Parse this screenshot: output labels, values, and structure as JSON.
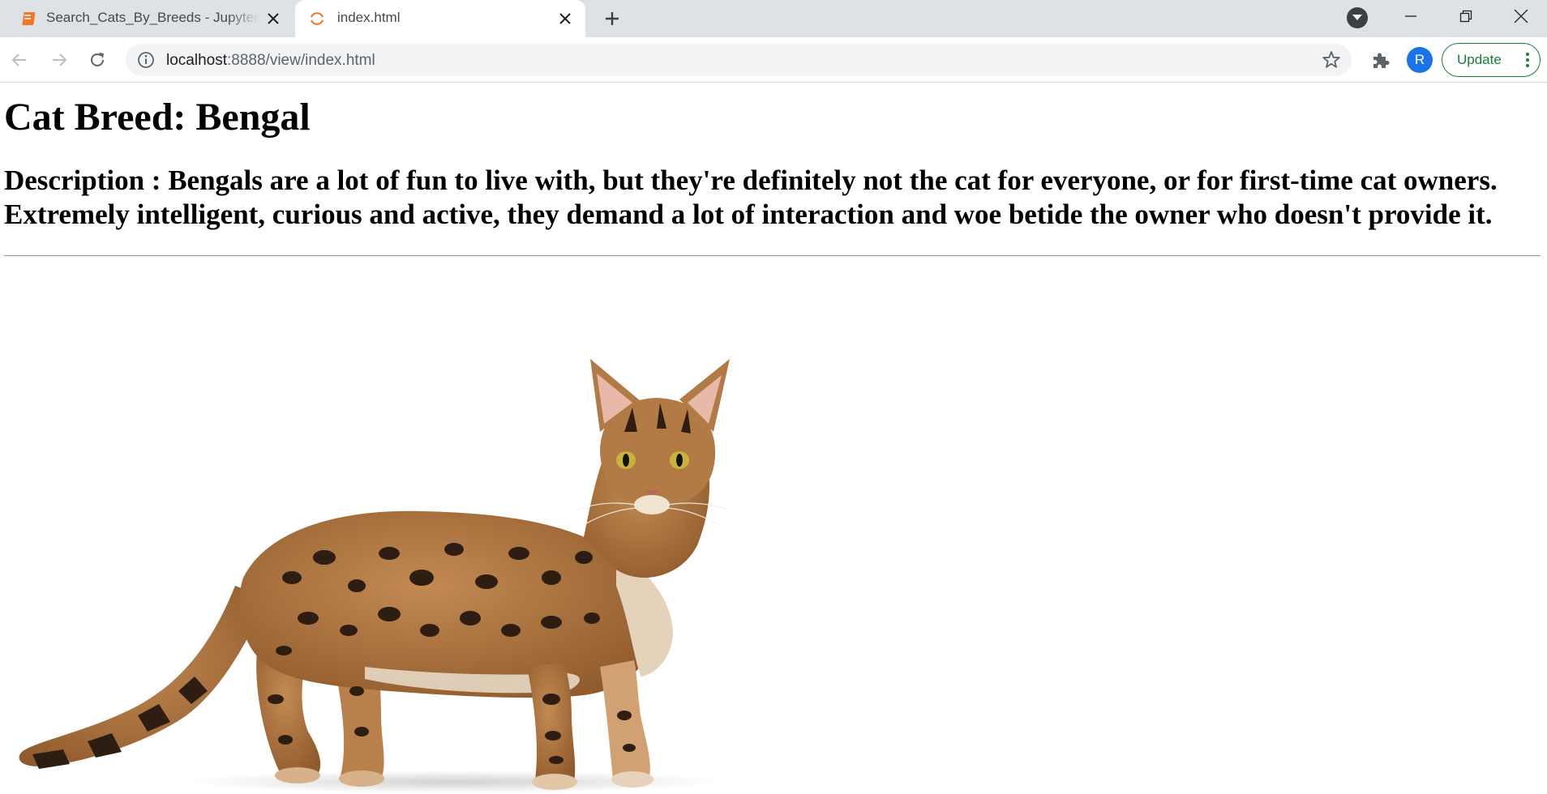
{
  "browser": {
    "tabs": [
      {
        "title": "Search_Cats_By_Breeds - Jupyter",
        "favicon": "jupyter-notebook-icon",
        "active": false
      },
      {
        "title": "index.html",
        "favicon": "jupyter-loading-icon",
        "active": true
      }
    ],
    "address": {
      "host": "localhost",
      "path": ":8888/view/index.html"
    },
    "profile_initial": "R",
    "update_label": "Update",
    "colors": {
      "tabstrip": "#dee1e6",
      "omnibox": "#f1f3f4",
      "avatar": "#1a73e8",
      "update": "#188038"
    }
  },
  "page": {
    "heading": "Cat Breed: Bengal",
    "description": "Description : Bengals are a lot of fun to live with, but they're definitely not the cat for everyone, or for first-time cat owners. Extremely intelligent, curious and active, they demand a lot of interaction and woe betide the owner who doesn't provide it.",
    "image": {
      "subject": "bengal-cat",
      "colors": {
        "coat": "#b27a44",
        "spots": "#2e1e12",
        "belly": "#eadfcd"
      }
    }
  }
}
